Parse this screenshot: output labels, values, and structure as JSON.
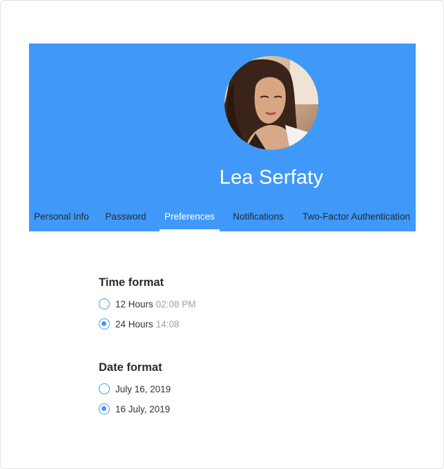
{
  "profile": {
    "name": "Lea Serfaty"
  },
  "tabs": [
    {
      "label": "Personal Info"
    },
    {
      "label": "Password"
    },
    {
      "label": "Preferences",
      "active": true
    },
    {
      "label": "Notifications"
    },
    {
      "label": "Two-Factor Authentication"
    }
  ],
  "time_format": {
    "title": "Time format",
    "options": [
      {
        "label": "12 Hours",
        "sample": "02:08 PM",
        "selected": false
      },
      {
        "label": "24 Hours",
        "sample": "14:08",
        "selected": true
      }
    ]
  },
  "date_format": {
    "title": "Date format",
    "options": [
      {
        "label": "July 16, 2019",
        "selected": false
      },
      {
        "label": "16 July, 2019",
        "selected": true
      }
    ]
  },
  "colors": {
    "header_bg": "#4099f8",
    "accent": "#4099f8"
  }
}
